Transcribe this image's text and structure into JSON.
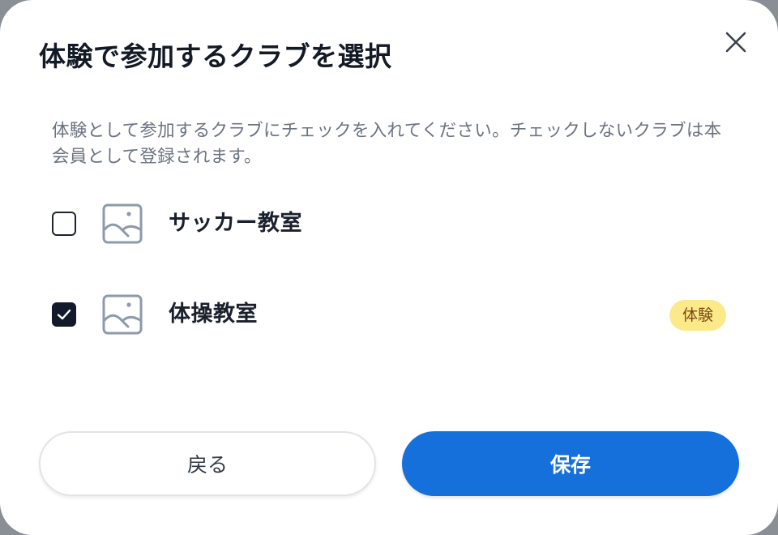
{
  "dialog": {
    "title": "体験で参加するクラブを選択",
    "close_icon": "close-icon",
    "description": "体験として参加するクラブにチェックを入れてください。チェックしないクラブは本会員として登録されます。"
  },
  "clubs": [
    {
      "name": "サッカー教室",
      "checked": false,
      "image_icon": "image-placeholder-icon",
      "badge": ""
    },
    {
      "name": "体操教室",
      "checked": true,
      "image_icon": "image-placeholder-icon",
      "badge": "体験"
    }
  ],
  "buttons": {
    "back_label": "戻る",
    "save_label": "保存"
  },
  "colors": {
    "primary": "#1570db",
    "checkbox_checked": "#131a2b",
    "badge_bg": "#fbe98a",
    "badge_text": "#7a4a12",
    "placeholder_icon": "#8d9aab"
  }
}
